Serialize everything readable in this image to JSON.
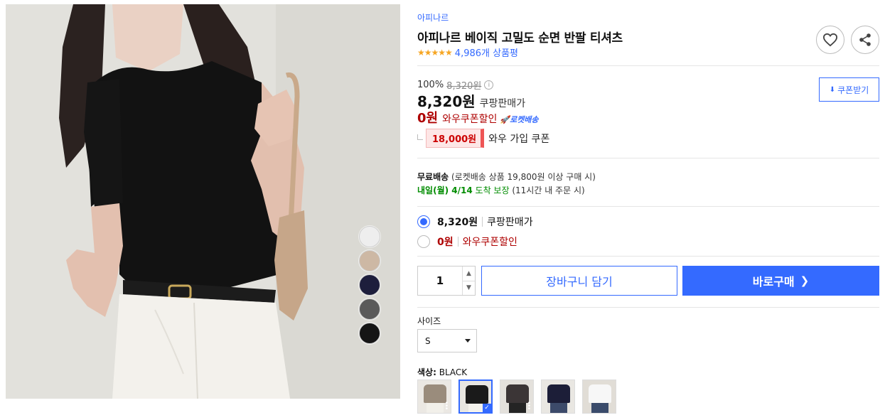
{
  "product": {
    "brand": "아피나르",
    "title": "아피나르 베이직 고밀도 순면 반팔 티셔츠",
    "rating_stars": "★★★★★",
    "review_count": "4,986개 상품평"
  },
  "price": {
    "discount_rate": "100%",
    "original_price": "8,320원",
    "coupang_price": "8,320원",
    "coupang_label": "쿠팡판매가",
    "wow_price": "0원",
    "wow_label": "와우쿠폰할인",
    "rocket_label": "🚀로켓배송",
    "coupon_amount": "18,000원",
    "coupon_text": "와우 가입 쿠폰",
    "coupon_button": "쿠폰받기"
  },
  "shipping": {
    "free_label": "무료배송",
    "free_desc": "(로켓배송 상품 19,800원 이상 구매 시)",
    "arrival_date": "내일(월) 4/14",
    "arrival_text": "도착 보장",
    "arrival_cond": "(11시간 내 주문 시)"
  },
  "options": [
    {
      "price": "8,320원",
      "label": "쿠팡판매가",
      "selected": true
    },
    {
      "price": "0원",
      "label": "와우쿠폰할인",
      "selected": false
    }
  ],
  "purchase": {
    "quantity": "1",
    "cart_label": "장바구니 담기",
    "buy_label": "바로구매"
  },
  "size": {
    "label": "사이즈",
    "selected": "S"
  },
  "color": {
    "label": "색상:",
    "selected": "BLACK",
    "thumb_colors": [
      "#9a8c7c",
      "#1a1a1a",
      "#3b3536",
      "#1c1e38",
      "#f4f4f4"
    ]
  },
  "photo_swatches": [
    "#eeeeee",
    "#cdb8a4",
    "#1d1e3c",
    "#5a5a5a",
    "#151515"
  ],
  "colors": {
    "accent": "#346aff",
    "wow_red": "#ae0000",
    "arrival_green": "#008c00"
  }
}
